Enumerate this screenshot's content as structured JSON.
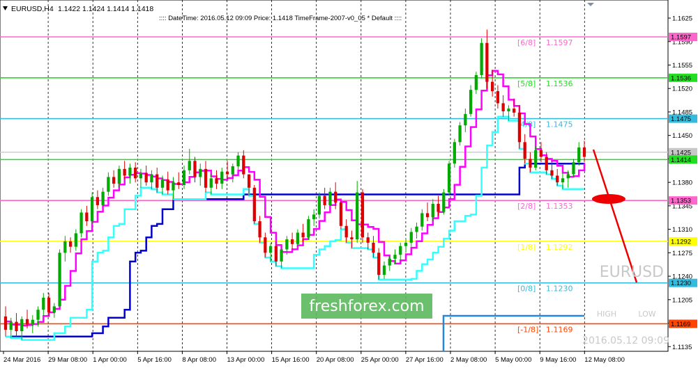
{
  "header": {
    "symbol": "EURUSD,H4",
    "ohlc": "1.1422 1.1424 1.1414 1.1418",
    "info": ":::: DateTime: 2016.05.12 09:09    Price: 1.1418    TimeFrame-2007-v0_05    *    Default    ::::"
  },
  "watermark": {
    "symbol": "EURUSD",
    "brand": "freshforex.com",
    "datetime": "2016.05.12 09:09",
    "high_label": "HIGH",
    "low_label": "LOW"
  },
  "colors": {
    "bull": "#00aa00",
    "bear": "#dd0000",
    "cyan": "#33ffff",
    "magenta": "#ff00ff",
    "blue": "#0000cc",
    "brand_bg": "#5cb85c",
    "arrow": "#ee0000"
  },
  "chart_data": {
    "type": "candlestick",
    "symbol": "EURUSD",
    "timeframe": "H4",
    "ylim": [
      1.1128,
      1.1652
    ],
    "y_ticks": [
      "1.1625",
      "1.1590",
      "1.1555",
      "1.1520",
      "1.1485",
      "1.1450",
      "1.1415",
      "1.1380",
      "1.1345",
      "1.1310",
      "1.1275",
      "1.1240",
      "1.1205",
      "1.1170",
      "1.1135"
    ],
    "x_ticks": [
      "24 Mar 2016",
      "29 Mar 08:00",
      "1 Apr 00:00",
      "5 Apr 16:00",
      "8 Apr 08:00",
      "13 Apr 00:00",
      "15 Apr 16:00",
      "20 Apr 08:00",
      "25 Apr 00:00",
      "27 Apr 16:00",
      "2 May 08:00",
      "5 May 00:00",
      "9 May 16:00",
      "12 May 08:00"
    ],
    "levels": [
      {
        "label": "[6/8]",
        "value": "1.1597",
        "color": "#ff66cc"
      },
      {
        "label": "[5/8]",
        "value": "1.1536",
        "color": "#22dd22"
      },
      {
        "label": "[4/8]",
        "value": "1.1475",
        "color": "#33bbdd"
      },
      {
        "label": "[2/8]",
        "value": "1.1353",
        "color": "#ff66cc"
      },
      {
        "label": "[1/8]",
        "value": "1.1292",
        "color": "#ffff00"
      },
      {
        "label": "[0/8]",
        "value": "1.1230",
        "color": "#33bbdd"
      },
      {
        "label": "[-1/8]",
        "value": "1.1169",
        "color": "#ff4400"
      }
    ],
    "price_tags": [
      {
        "value": "1.1425",
        "color": "#c8c8c8"
      },
      {
        "value": "1.1414",
        "color": "#22dd22"
      }
    ],
    "current_price": 1.1418,
    "candles": [
      [
        1.118,
        1.1195,
        1.115,
        1.116
      ],
      [
        1.116,
        1.1178,
        1.1148,
        1.1172
      ],
      [
        1.1172,
        1.1185,
        1.115,
        1.1158
      ],
      [
        1.1158,
        1.118,
        1.1145,
        1.1176
      ],
      [
        1.1176,
        1.119,
        1.1162,
        1.1168
      ],
      [
        1.1168,
        1.1182,
        1.1155,
        1.1175
      ],
      [
        1.1175,
        1.1195,
        1.1165,
        1.119
      ],
      [
        1.119,
        1.1215,
        1.1182,
        1.1208
      ],
      [
        1.1208,
        1.1215,
        1.118,
        1.1186
      ],
      [
        1.1186,
        1.12,
        1.1178,
        1.1195
      ],
      [
        1.1195,
        1.128,
        1.119,
        1.1275
      ],
      [
        1.1275,
        1.13,
        1.1262,
        1.1292
      ],
      [
        1.1292,
        1.1298,
        1.1275,
        1.1284
      ],
      [
        1.1284,
        1.131,
        1.1278,
        1.1304
      ],
      [
        1.1304,
        1.134,
        1.1298,
        1.1335
      ],
      [
        1.1335,
        1.1345,
        1.1315,
        1.1322
      ],
      [
        1.1322,
        1.1365,
        1.1318,
        1.1358
      ],
      [
        1.1358,
        1.1368,
        1.134,
        1.1346
      ],
      [
        1.1346,
        1.1372,
        1.134,
        1.1366
      ],
      [
        1.1366,
        1.1395,
        1.136,
        1.1388
      ],
      [
        1.1388,
        1.1398,
        1.1372,
        1.1378
      ],
      [
        1.1378,
        1.1405,
        1.1372,
        1.14
      ],
      [
        1.14,
        1.1412,
        1.1385,
        1.139
      ],
      [
        1.139,
        1.1408,
        1.1378,
        1.1402
      ],
      [
        1.1402,
        1.141,
        1.138,
        1.1386
      ],
      [
        1.1386,
        1.14,
        1.1372,
        1.1394
      ],
      [
        1.1394,
        1.1405,
        1.1375,
        1.138
      ],
      [
        1.138,
        1.1398,
        1.137,
        1.1392
      ],
      [
        1.1392,
        1.1402,
        1.1365,
        1.1372
      ],
      [
        1.1372,
        1.139,
        1.1362,
        1.1384
      ],
      [
        1.1384,
        1.1396,
        1.1362,
        1.1368
      ],
      [
        1.1368,
        1.1388,
        1.1355,
        1.138
      ],
      [
        1.138,
        1.1395,
        1.137,
        1.1376
      ],
      [
        1.1376,
        1.1405,
        1.137,
        1.1398
      ],
      [
        1.1398,
        1.143,
        1.1392,
        1.1412
      ],
      [
        1.1412,
        1.1418,
        1.138,
        1.1388
      ],
      [
        1.1388,
        1.1408,
        1.1375,
        1.14
      ],
      [
        1.14,
        1.1412,
        1.1365,
        1.1372
      ],
      [
        1.1372,
        1.1392,
        1.1362,
        1.1386
      ],
      [
        1.1386,
        1.1398,
        1.137,
        1.1378
      ],
      [
        1.1378,
        1.1402,
        1.137,
        1.1396
      ],
      [
        1.1396,
        1.1412,
        1.1385,
        1.1392
      ],
      [
        1.1392,
        1.1408,
        1.138,
        1.1404
      ],
      [
        1.1404,
        1.1425,
        1.1398,
        1.142
      ],
      [
        1.142,
        1.1428,
        1.1386,
        1.1392
      ],
      [
        1.1392,
        1.138,
        1.136,
        1.1372
      ],
      [
        1.1372,
        1.1376,
        1.1318,
        1.1322
      ],
      [
        1.1322,
        1.133,
        1.129,
        1.1298
      ],
      [
        1.1298,
        1.1305,
        1.1268,
        1.1275
      ],
      [
        1.1275,
        1.129,
        1.1262,
        1.1285
      ],
      [
        1.1285,
        1.1292,
        1.1255,
        1.1262
      ],
      [
        1.1262,
        1.1285,
        1.1252,
        1.128
      ],
      [
        1.128,
        1.13,
        1.1272,
        1.1295
      ],
      [
        1.1295,
        1.1305,
        1.128,
        1.1288
      ],
      [
        1.1288,
        1.131,
        1.1285,
        1.1305
      ],
      [
        1.1305,
        1.1318,
        1.1292,
        1.1298
      ],
      [
        1.1298,
        1.133,
        1.1294,
        1.1325
      ],
      [
        1.1325,
        1.134,
        1.1315,
        1.1332
      ],
      [
        1.1332,
        1.1365,
        1.1326,
        1.136
      ],
      [
        1.136,
        1.1372,
        1.134,
        1.1346
      ],
      [
        1.1346,
        1.1372,
        1.134,
        1.1366
      ],
      [
        1.1366,
        1.138,
        1.134,
        1.135
      ],
      [
        1.135,
        1.1352,
        1.131,
        1.1315
      ],
      [
        1.1315,
        1.1325,
        1.129,
        1.1298
      ],
      [
        1.1298,
        1.1308,
        1.1282,
        1.1295
      ],
      [
        1.1295,
        1.1382,
        1.129,
        1.1365
      ],
      [
        1.1365,
        1.137,
        1.129,
        1.1298
      ],
      [
        1.1298,
        1.1305,
        1.128,
        1.129
      ],
      [
        1.129,
        1.13,
        1.1268,
        1.1275
      ],
      [
        1.1275,
        1.1282,
        1.1235,
        1.1242
      ],
      [
        1.1242,
        1.1262,
        1.1236,
        1.1256
      ],
      [
        1.1256,
        1.127,
        1.1248,
        1.1266
      ],
      [
        1.1266,
        1.128,
        1.1258,
        1.1272
      ],
      [
        1.1272,
        1.129,
        1.1265,
        1.1285
      ],
      [
        1.1285,
        1.1296,
        1.1275,
        1.129
      ],
      [
        1.129,
        1.1312,
        1.1284,
        1.1306
      ],
      [
        1.1306,
        1.132,
        1.1296,
        1.1314
      ],
      [
        1.1314,
        1.134,
        1.1308,
        1.1334
      ],
      [
        1.1334,
        1.135,
        1.1322,
        1.1328
      ],
      [
        1.1328,
        1.1355,
        1.1322,
        1.1348
      ],
      [
        1.1348,
        1.136,
        1.133,
        1.1336
      ],
      [
        1.1336,
        1.137,
        1.1332,
        1.1365
      ],
      [
        1.1365,
        1.1412,
        1.136,
        1.1408
      ],
      [
        1.1408,
        1.1445,
        1.1402,
        1.144
      ],
      [
        1.144,
        1.147,
        1.1435,
        1.1465
      ],
      [
        1.1465,
        1.149,
        1.1455,
        1.1482
      ],
      [
        1.1482,
        1.1525,
        1.1478,
        1.1518
      ],
      [
        1.1518,
        1.1545,
        1.1512,
        1.154
      ],
      [
        1.154,
        1.1595,
        1.1535,
        1.1588
      ],
      [
        1.1588,
        1.1608,
        1.152,
        1.153
      ],
      [
        1.153,
        1.1548,
        1.1508,
        1.1516
      ],
      [
        1.1516,
        1.1525,
        1.149,
        1.1498
      ],
      [
        1.1498,
        1.151,
        1.1478,
        1.1486
      ],
      [
        1.1486,
        1.1495,
        1.1472,
        1.149
      ],
      [
        1.149,
        1.1505,
        1.1478,
        1.1484
      ],
      [
        1.1484,
        1.1495,
        1.143,
        1.144
      ],
      [
        1.144,
        1.1452,
        1.1408,
        1.1415
      ],
      [
        1.1415,
        1.1425,
        1.1395,
        1.1402
      ],
      [
        1.1402,
        1.1435,
        1.1398,
        1.1428
      ],
      [
        1.1428,
        1.144,
        1.141,
        1.1418
      ],
      [
        1.1418,
        1.1425,
        1.1392,
        1.1398
      ],
      [
        1.1398,
        1.1412,
        1.1385,
        1.139
      ],
      [
        1.139,
        1.14,
        1.1375,
        1.138
      ],
      [
        1.138,
        1.1395,
        1.137,
        1.1386
      ],
      [
        1.1386,
        1.1398,
        1.1372,
        1.1392
      ],
      [
        1.1392,
        1.1415,
        1.1388,
        1.141
      ],
      [
        1.141,
        1.144,
        1.1405,
        1.1432
      ],
      [
        1.1432,
        1.1442,
        1.141,
        1.1418
      ]
    ]
  }
}
